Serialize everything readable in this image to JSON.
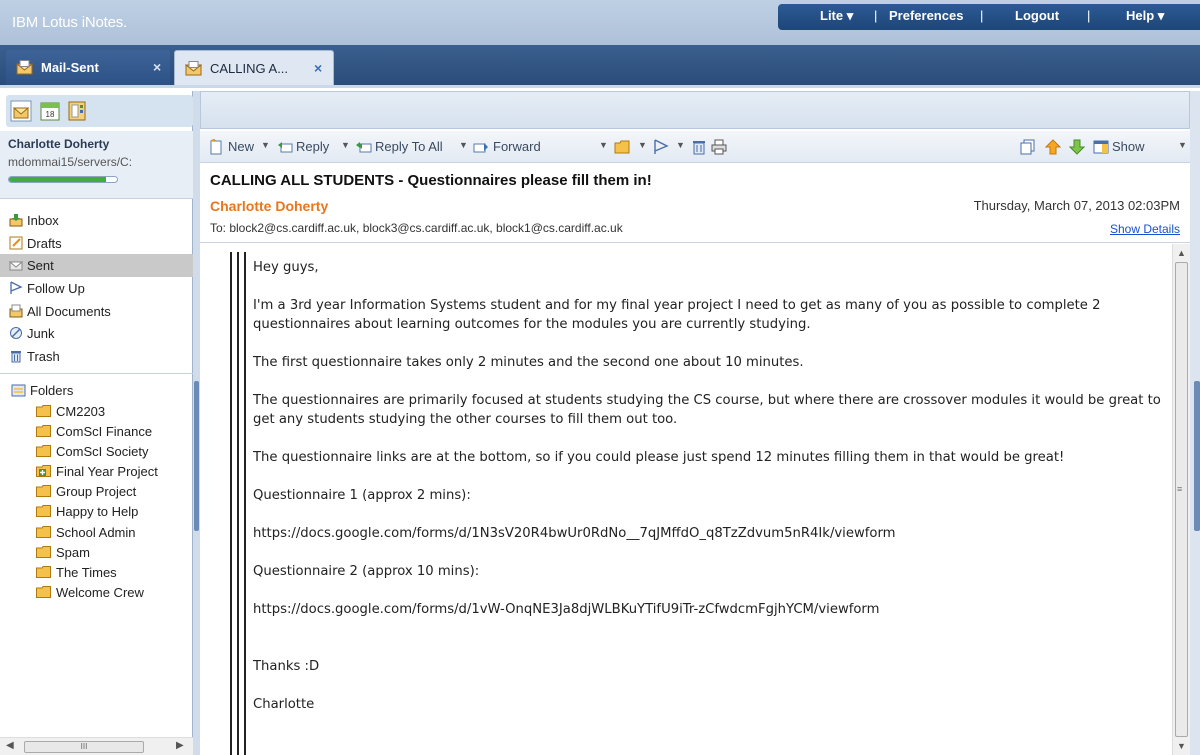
{
  "app": {
    "brand": "IBM Lotus iNotes."
  },
  "topmenu": {
    "lite": "Lite ▾",
    "preferences": "Preferences",
    "logout": "Logout",
    "help": "Help ▾"
  },
  "tabs": [
    {
      "label": "Mail-Sent",
      "close": "×"
    },
    {
      "label": "CALLING A...",
      "close": "×"
    }
  ],
  "user": {
    "name": "Charlotte Doherty",
    "server": "mdommai15/servers/C:",
    "quota_fraction": 0.9
  },
  "nav": [
    {
      "label": "Inbox",
      "icon": "inbox-icon"
    },
    {
      "label": "Drafts",
      "icon": "drafts-icon"
    },
    {
      "label": "Sent",
      "icon": "sent-icon",
      "selected": true
    },
    {
      "label": "Follow Up",
      "icon": "flag-icon"
    },
    {
      "label": "All Documents",
      "icon": "all-documents-icon"
    },
    {
      "label": "Junk",
      "icon": "junk-icon"
    },
    {
      "label": "Trash",
      "icon": "trash-icon"
    }
  ],
  "folders": {
    "header": "Folders",
    "items": [
      "CM2203",
      "ComScI Finance",
      "ComScI Society",
      "Final Year Project",
      "Group Project",
      "Happy to Help",
      "School Admin",
      "Spam",
      "The Times",
      "Welcome Crew"
    ]
  },
  "leftscroll": {
    "thumb": "III"
  },
  "toolbar": {
    "new": "New",
    "reply": "Reply",
    "reply_all": "Reply To All",
    "forward": "Forward",
    "show": "Show"
  },
  "message": {
    "subject": "CALLING ALL STUDENTS - Questionnaires please fill them in!",
    "sender": "Charlotte Doherty",
    "date": "Thursday, March 07, 2013 02:03PM",
    "to": "To:  block2@cs.cardiff.ac.uk, block3@cs.cardiff.ac.uk, block1@cs.cardiff.ac.uk",
    "show_details": "Show Details",
    "body": {
      "greeting": "Hey guys,",
      "p1": "I'm a 3rd year Information Systems student and for my final year project I need to get as many of you as possible to complete 2 questionnaires about learning outcomes for the modules you are currently studying.",
      "p2": "The first questionnaire takes only 2 minutes and the second one about 10 minutes.",
      "p3": "The questionnaires are primarily focused at students studying the CS course, but where there are crossover modules it would be great to get any students studying the other courses to fill them out too.",
      "p4": "The questionnaire links are at the bottom, so if you could please just spend 12 minutes filling them in that would be great!",
      "q1_label": "Questionnaire 1 (approx 2 mins):",
      "q1_link": "https://docs.google.com/forms/d/1N3sV20R4bwUr0RdNo__7qJMffdO_q8TzZdvum5nR4Ik/viewform",
      "q2_label": "Questionnaire 2 (approx 10 mins):",
      "q2_link": "https://docs.google.com/forms/d/1vW-OnqNE3Ja8djWLBKuYTifU9iTr-zCfwdcmFgjhYCM/viewform",
      "thanks": "Thanks :D",
      "signature": "Charlotte"
    }
  },
  "colors": {
    "brand_bar": "#2c5a96",
    "sender": "#e8761f",
    "link": "#1a4fd0",
    "quota": "#3fae3f"
  }
}
